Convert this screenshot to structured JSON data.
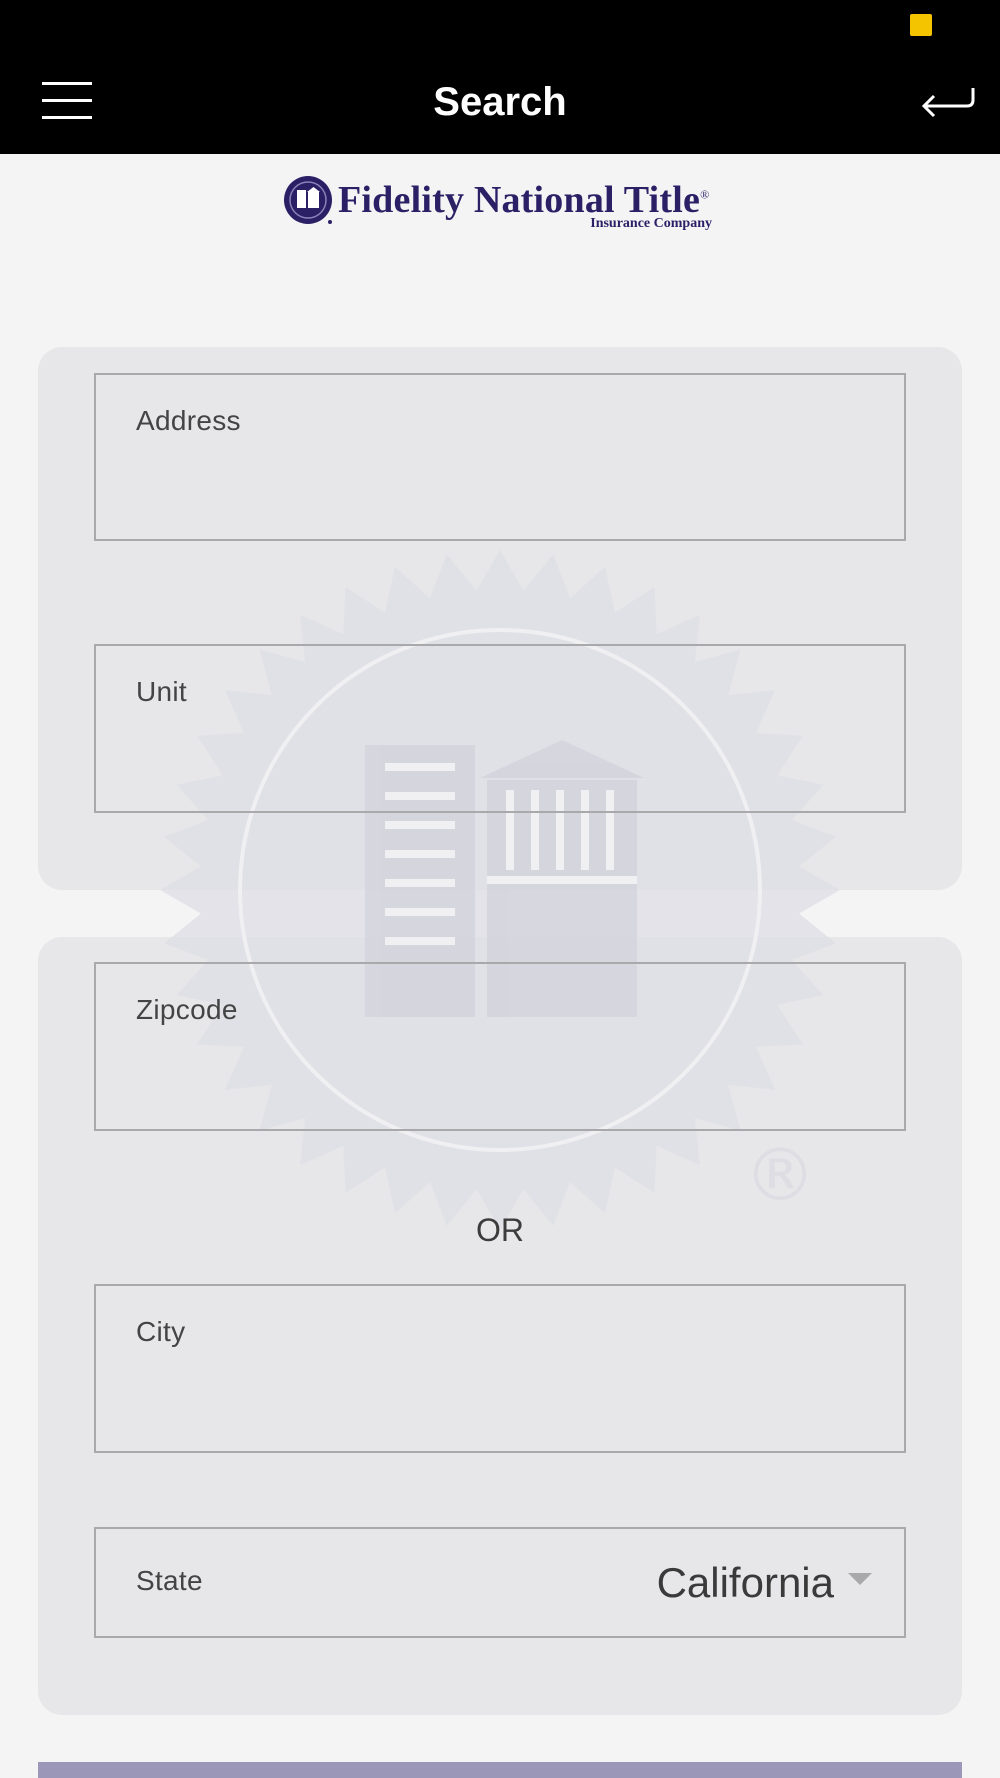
{
  "colors": {
    "nav_background": "#000000",
    "status_indicator": "#f5c400",
    "brand_purple": "#2b1f66",
    "submit_button": "#9b97b8"
  },
  "header": {
    "title": "Search",
    "menu_icon": "hamburger-menu-icon",
    "back_icon": "return-arrow-icon"
  },
  "logo": {
    "name": "Fidelity National Title",
    "trademark": "®",
    "subtitle": "Insurance Company",
    "emblem_icon": "buildings-seal-icon"
  },
  "watermark": {
    "mark": "®",
    "icon": "buildings-seal-watermark"
  },
  "form": {
    "address": {
      "label": "Address",
      "value": ""
    },
    "unit": {
      "label": "Unit",
      "value": ""
    },
    "zipcode": {
      "label": "Zipcode",
      "value": ""
    },
    "separator": "OR",
    "city": {
      "label": "City",
      "value": ""
    },
    "state": {
      "label": "State",
      "value": "California",
      "icon": "dropdown-caret-icon"
    }
  }
}
